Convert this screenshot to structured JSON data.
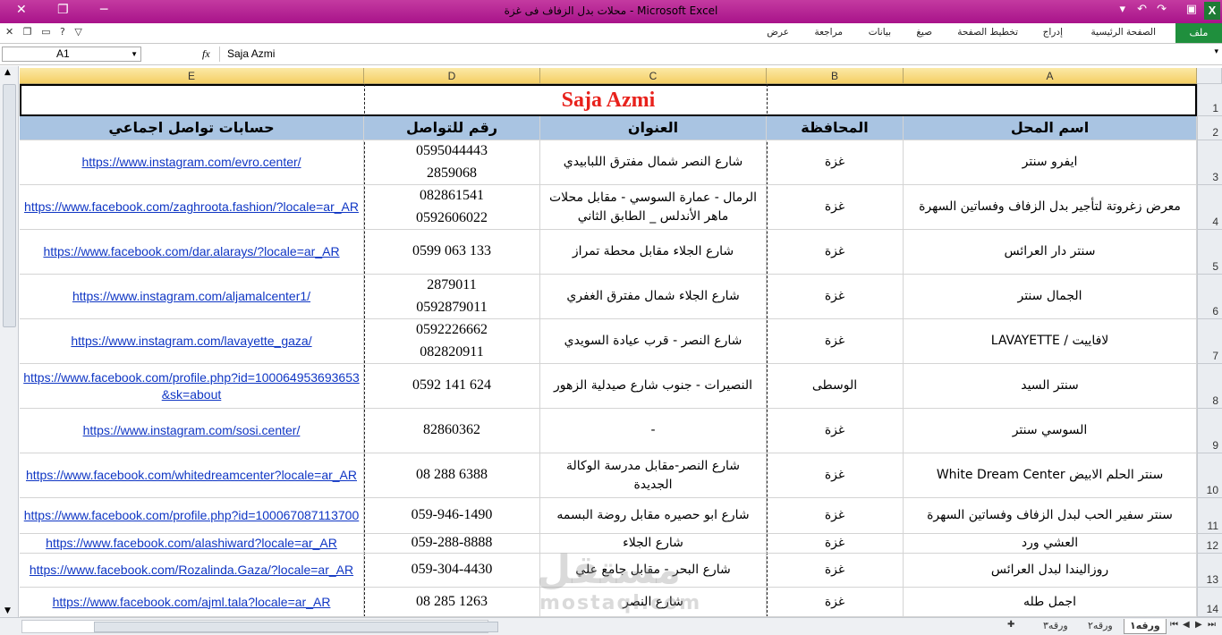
{
  "window": {
    "title": "محلات بدل الزفاف فى غزة  -  Microsoft Excel",
    "close_glyph": "✕",
    "restore_glyph": "❐",
    "minimize_glyph": "─",
    "logo": "X"
  },
  "ribbon": {
    "file": "ملف",
    "tabs": [
      "الصفحة الرئيسية",
      "إدراج",
      "تخطيط الصفحة",
      "صيغ",
      "بيانات",
      "مراجعة",
      "عرض"
    ]
  },
  "formula_bar": {
    "name_box": "A1",
    "fx": "fx",
    "content": "Saja Azmi"
  },
  "columns": [
    "E",
    "D",
    "C",
    "B",
    "A"
  ],
  "rows": [
    "1",
    "2",
    "3",
    "4",
    "5",
    "6",
    "7",
    "8",
    "9",
    "10",
    "11",
    "12",
    "13",
    "14"
  ],
  "title_cell": "Saja Azmi",
  "headers": {
    "social": "حسابات تواصل اجماعي",
    "phone": "رقم للتواصل",
    "address": "العنوان",
    "province": "المحافظة",
    "name": "اسم المحل"
  },
  "table": [
    {
      "name": "ايفرو سنتر",
      "province": "غزة",
      "address": "شارع النصر شمال مفترق اللبابيدي",
      "phone": "0595044443\n2859068",
      "social": "https://www.instagram.com/evro.center/"
    },
    {
      "name": "معرض زغروتة لتأجير بدل الزفاف وفساتين السهرة",
      "province": "غزة",
      "address": "الرمال - عمارة السوسي - مقابل محلات ماهر الأندلس _ الطابق الثاني",
      "phone": "082861541\n0592606022",
      "social": "https://www.facebook.com/zaghroota.fashion/?locale=ar_AR"
    },
    {
      "name": "سنتر دار العرائس",
      "province": "غزة",
      "address": "شارع الجلاء مقابل محطة تمراز",
      "phone": "0599 063 133",
      "social": "https://www.facebook.com/dar.alarays/?locale=ar_AR"
    },
    {
      "name": "الجمال سنتر",
      "province": "غزة",
      "address": "شارع الجلاء شمال مفترق الغفري",
      "phone": "2879011\n0592879011",
      "social": "https://www.instagram.com/aljamalcenter1/"
    },
    {
      "name": "لافاييت / LAVAYETTE",
      "province": "غزة",
      "address": "شارع النصر - قرب عيادة السويدي",
      "phone": "0592226662\n082820911",
      "social": "https://www.instagram.com/lavayette_gaza/"
    },
    {
      "name": "سنتر السيد",
      "province": "الوسطى",
      "address": "النصيرات - جنوب شارع صيدلية الزهور",
      "phone": "0592 141 624",
      "social": "https://www.facebook.com/profile.php?id=100064953693653&sk=about"
    },
    {
      "name": "السوسي سنتر",
      "province": "غزة",
      "address": "-",
      "phone": "82860362",
      "social": "https://www.instagram.com/sosi.center/"
    },
    {
      "name": "سنتر الحلم الابيض White Dream Center",
      "province": "غزة",
      "address": "شارع النصر-مقابل مدرسة الوكالة الجديدة",
      "phone": "08 288 6388",
      "social": "https://www.facebook.com/whitedreamcenter?locale=ar_AR"
    },
    {
      "name": "سنتر سفير الحب لبدل الزفاف وفساتين السهرة",
      "province": "غزة",
      "address": "شارع ابو حصيره مقابل روضة البسمه",
      "phone": "059-946-1490",
      "social": "https://www.facebook.com/profile.php?id=100067087113700"
    },
    {
      "name": "العشي ورد",
      "province": "غزة",
      "address": "شارع الجلاء",
      "phone": "059-288-8888",
      "social": "https://www.facebook.com/alashiward?locale=ar_AR"
    },
    {
      "name": "روزاليندا لبدل العرائس",
      "province": "غزة",
      "address": "شارع البحر - مقابل جامع علي",
      "phone": "059-304-4430",
      "social": "https://www.facebook.com/Rozalinda.Gaza/?locale=ar_AR"
    },
    {
      "name": "اجمل طله",
      "province": "غزة",
      "address": "شارع النصر",
      "phone": "08 285 1263",
      "social": "https://www.facebook.com/ajml.tala?locale=ar_AR"
    }
  ],
  "sheets": [
    "ورقه١",
    "ورقه٢",
    "ورقه٣"
  ],
  "watermark": {
    "line1": "مستقل",
    "line2": "mostaql.com"
  }
}
